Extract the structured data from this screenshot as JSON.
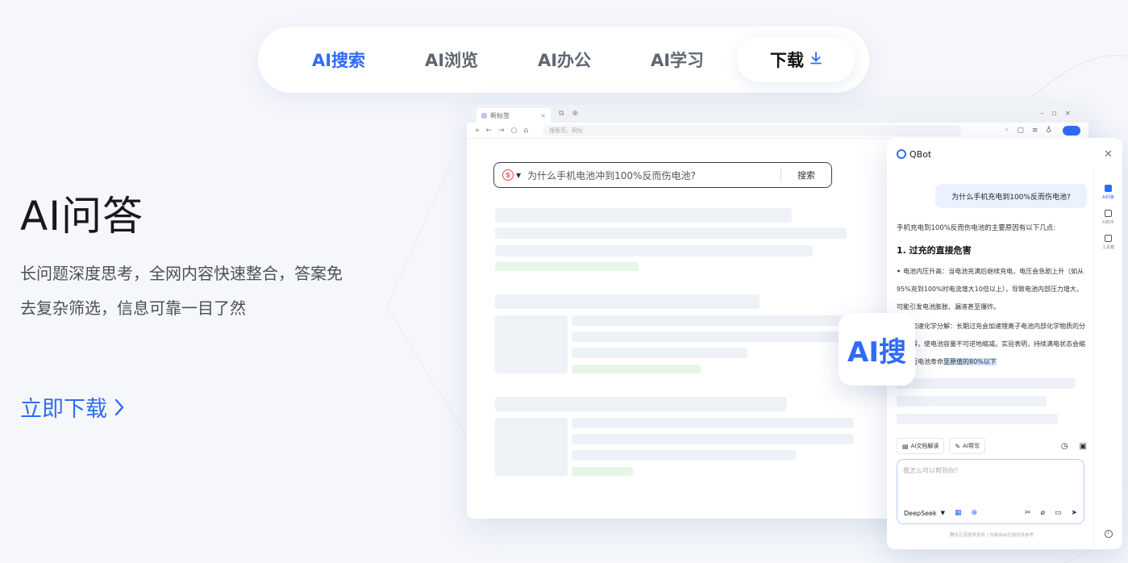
{
  "nav": {
    "tabs": [
      {
        "label": "AI搜索",
        "active": true
      },
      {
        "label": "AI浏览",
        "active": false
      },
      {
        "label": "AI办公",
        "active": false
      },
      {
        "label": "AI学习",
        "active": false
      }
    ],
    "download_label": "下载"
  },
  "hero": {
    "title": "AI问答",
    "description_line1": "长问题深度思考，全网内容快速整合，答案免",
    "description_line2": "去复杂筛选，信息可靠一目了然",
    "cta_label": "立即下载"
  },
  "browser": {
    "tab_title": "新标签",
    "address_placeholder": "搜索页、网址",
    "search": {
      "query": "为什么手机电池冲到100%反而伤电池?",
      "button_label": "搜索"
    }
  },
  "ai_bubble": {
    "label": "AI搜"
  },
  "qbot": {
    "title": "QBot",
    "user_message": "为什么手机充电到100%反而伤电池?",
    "answer_intro": "手机充电到100%反而伤电池的主要原因有以下几点:",
    "answer_heading": "1. 过充的直接危害",
    "answer_point1": "电池内压升高：当电池充满后继续充电，电压会急剧上升（如从95%充到100%时电流增大10倍以上），导致电池内部压力增大，可能引发电池膨胀、漏液甚至爆炸。",
    "answer_point2_a": "加速化学分解：长期过充会加速锂离子电池内部化学物质的分解，使电池容量不可逆地缩减。实验表明，持续满电状态会缩短电池寿命",
    "answer_point2_b": "至原值的80%以下",
    "sidebar": [
      {
        "label": "AI问答",
        "active": true
      },
      {
        "label": "AI助手",
        "active": false
      },
      {
        "label": "工具箱",
        "active": false
      }
    ],
    "tools": [
      {
        "icon": "document-icon",
        "label": "AI文档解读"
      },
      {
        "icon": "pen-icon",
        "label": "AI帮写"
      }
    ],
    "input_placeholder": "我怎么可以帮到你？",
    "model": "DeepSeek",
    "footer": "腾讯元宝提供支持 | 内容由AI生成仅供参考"
  },
  "colors": {
    "accent": "#2f6bf5",
    "background": "#f5f7fb"
  }
}
